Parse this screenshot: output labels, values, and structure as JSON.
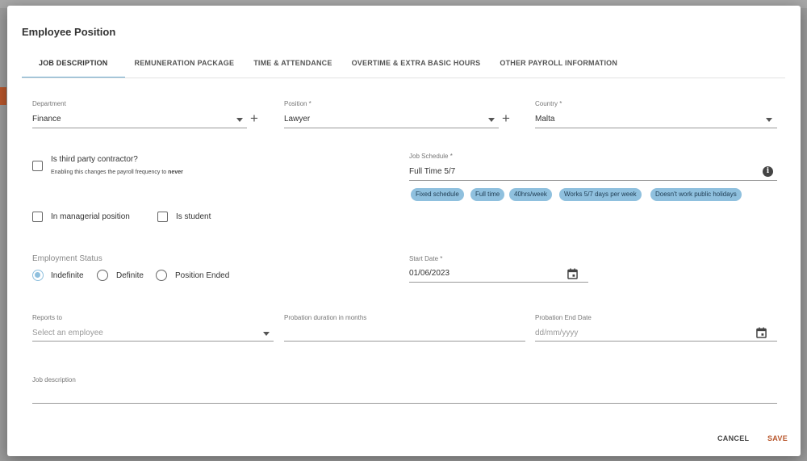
{
  "dialog": {
    "title": "Employee Position",
    "tabs": [
      {
        "label": "JOB DESCRIPTION"
      },
      {
        "label": "REMUNERATION PACKAGE"
      },
      {
        "label": "TIME & ATTENDANCE"
      },
      {
        "label": "OVERTIME & EXTRA BASIC HOURS"
      },
      {
        "label": "OTHER PAYROLL INFORMATION"
      }
    ]
  },
  "form": {
    "department": {
      "label": "Department",
      "value": "Finance"
    },
    "position": {
      "label": "Position *",
      "value": "Lawyer"
    },
    "country": {
      "label": "Country *",
      "value": "Malta"
    },
    "third_party": {
      "label": "Is third party contractor?",
      "hint_prefix": "Enabling this changes the payroll frequency to",
      "hint_bold": "never"
    },
    "job_schedule": {
      "label": "Job Schedule *",
      "value": "Full Time 5/7",
      "chips": [
        "Fixed schedule",
        "Full time",
        "40hrs/week",
        "Works 5/7 days per week",
        "Doesn't work public holidays"
      ]
    },
    "managerial": {
      "label": "In managerial position"
    },
    "student": {
      "label": "Is student"
    },
    "employment_status": {
      "label": "Employment Status",
      "options": [
        "Indefinite",
        "Definite",
        "Position Ended"
      ],
      "selected": "Indefinite"
    },
    "start_date": {
      "label": "Start Date *",
      "value": "01/06/2023"
    },
    "reports_to": {
      "label": "Reports to",
      "placeholder": "Select an employee"
    },
    "probation_duration": {
      "label": "Probation duration in months",
      "value": ""
    },
    "probation_end": {
      "label": "Probation End Date",
      "placeholder": "dd/mm/yyyy"
    },
    "job_description": {
      "label": "Job description",
      "value": ""
    }
  },
  "actions": {
    "cancel": "CANCEL",
    "save": "SAVE"
  },
  "colors": {
    "accent": "#8fc0de",
    "save": "#b8562b",
    "tab_indicator": "#6aa7cc"
  }
}
